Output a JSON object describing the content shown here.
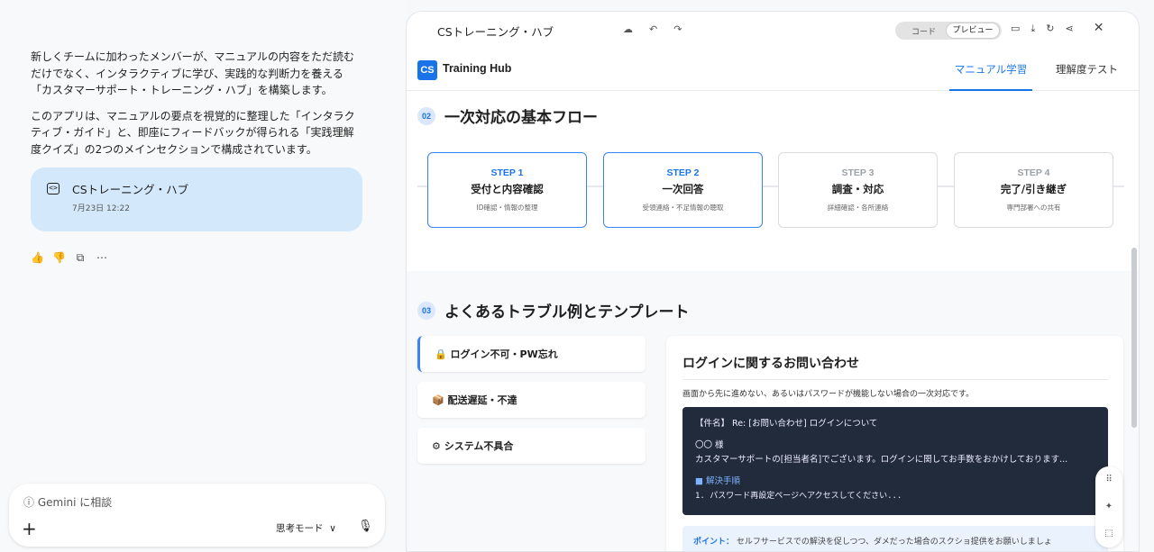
{
  "chat": {
    "paragraph1": "新しくチームに加わったメンバーが、マニュアルの内容をただ読むだけでなく、インタラクティブに学び、実践的な判断力を養える「カスタマーサポート・トレーニング・ハブ」を構築します。",
    "paragraph2": "このアプリは、マニュアルの要点を視覚的に整理した「インタラクティブ・ガイド」と、即座にフィードバックが得られる「実践理解度クイズ」の2つのメインセクションで構成されています。",
    "card_title": "CSトレーニング・ハブ",
    "card_date": "7月23日 12:22",
    "input_placeholder": "Gemini に相談",
    "mode_label": "思考モード",
    "mode_chevron": "∨"
  },
  "preview": {
    "title": "CSトレーニング・ハブ",
    "toggle_code": "コード",
    "toggle_preview": "プレビュー"
  },
  "app": {
    "logo": "CS",
    "brand": "Training Hub",
    "nav_manual": "マニュアル学習",
    "nav_test": "理解度テスト",
    "section2_num": "02",
    "section2_title": "一次対応の基本フロー",
    "steps": [
      {
        "label": "STEP 1",
        "name": "受付と内容確認",
        "sub": "ID確認・情報の整理"
      },
      {
        "label": "STEP 2",
        "name": "一次回答",
        "sub": "受領連絡・不足情報の聴取"
      },
      {
        "label": "STEP 3",
        "name": "調査・対応",
        "sub": "詳細確認・各所連絡"
      },
      {
        "label": "STEP 4",
        "name": "完了/引き継ぎ",
        "sub": "専門部署への共有"
      }
    ],
    "section3_num": "03",
    "section3_title": "よくあるトラブル例とテンプレート",
    "tabs": [
      {
        "icon": "🔒",
        "label": "ログイン不可・PW忘れ"
      },
      {
        "icon": "📦",
        "label": "配送遅延・不達"
      },
      {
        "icon": "⚙",
        "label": "システム不具合"
      }
    ],
    "panel_title": "ログインに関するお問い合わせ",
    "panel_desc": "画面から先に進めない、あるいはパスワードが機能しない場合の一次対応です。",
    "code_subject": "【件名】 Re: [お問い合わせ] ログインについて",
    "code_to": "〇〇 様",
    "code_body": "カスタマーサポートの[担当者名]でございます。ログインに関してお手数をおかけしております...",
    "code_step_head": "■ 解決手順",
    "code_step1": "1. パスワード再設定ページへアクセスしてください...",
    "point_label": "ポイント：",
    "point_text": "セルフサービスでの解決を促しつつ、ダメだった場合のスクショ提供をお願いしましょ"
  },
  "icons": {
    "accent": "#1a73e8"
  }
}
